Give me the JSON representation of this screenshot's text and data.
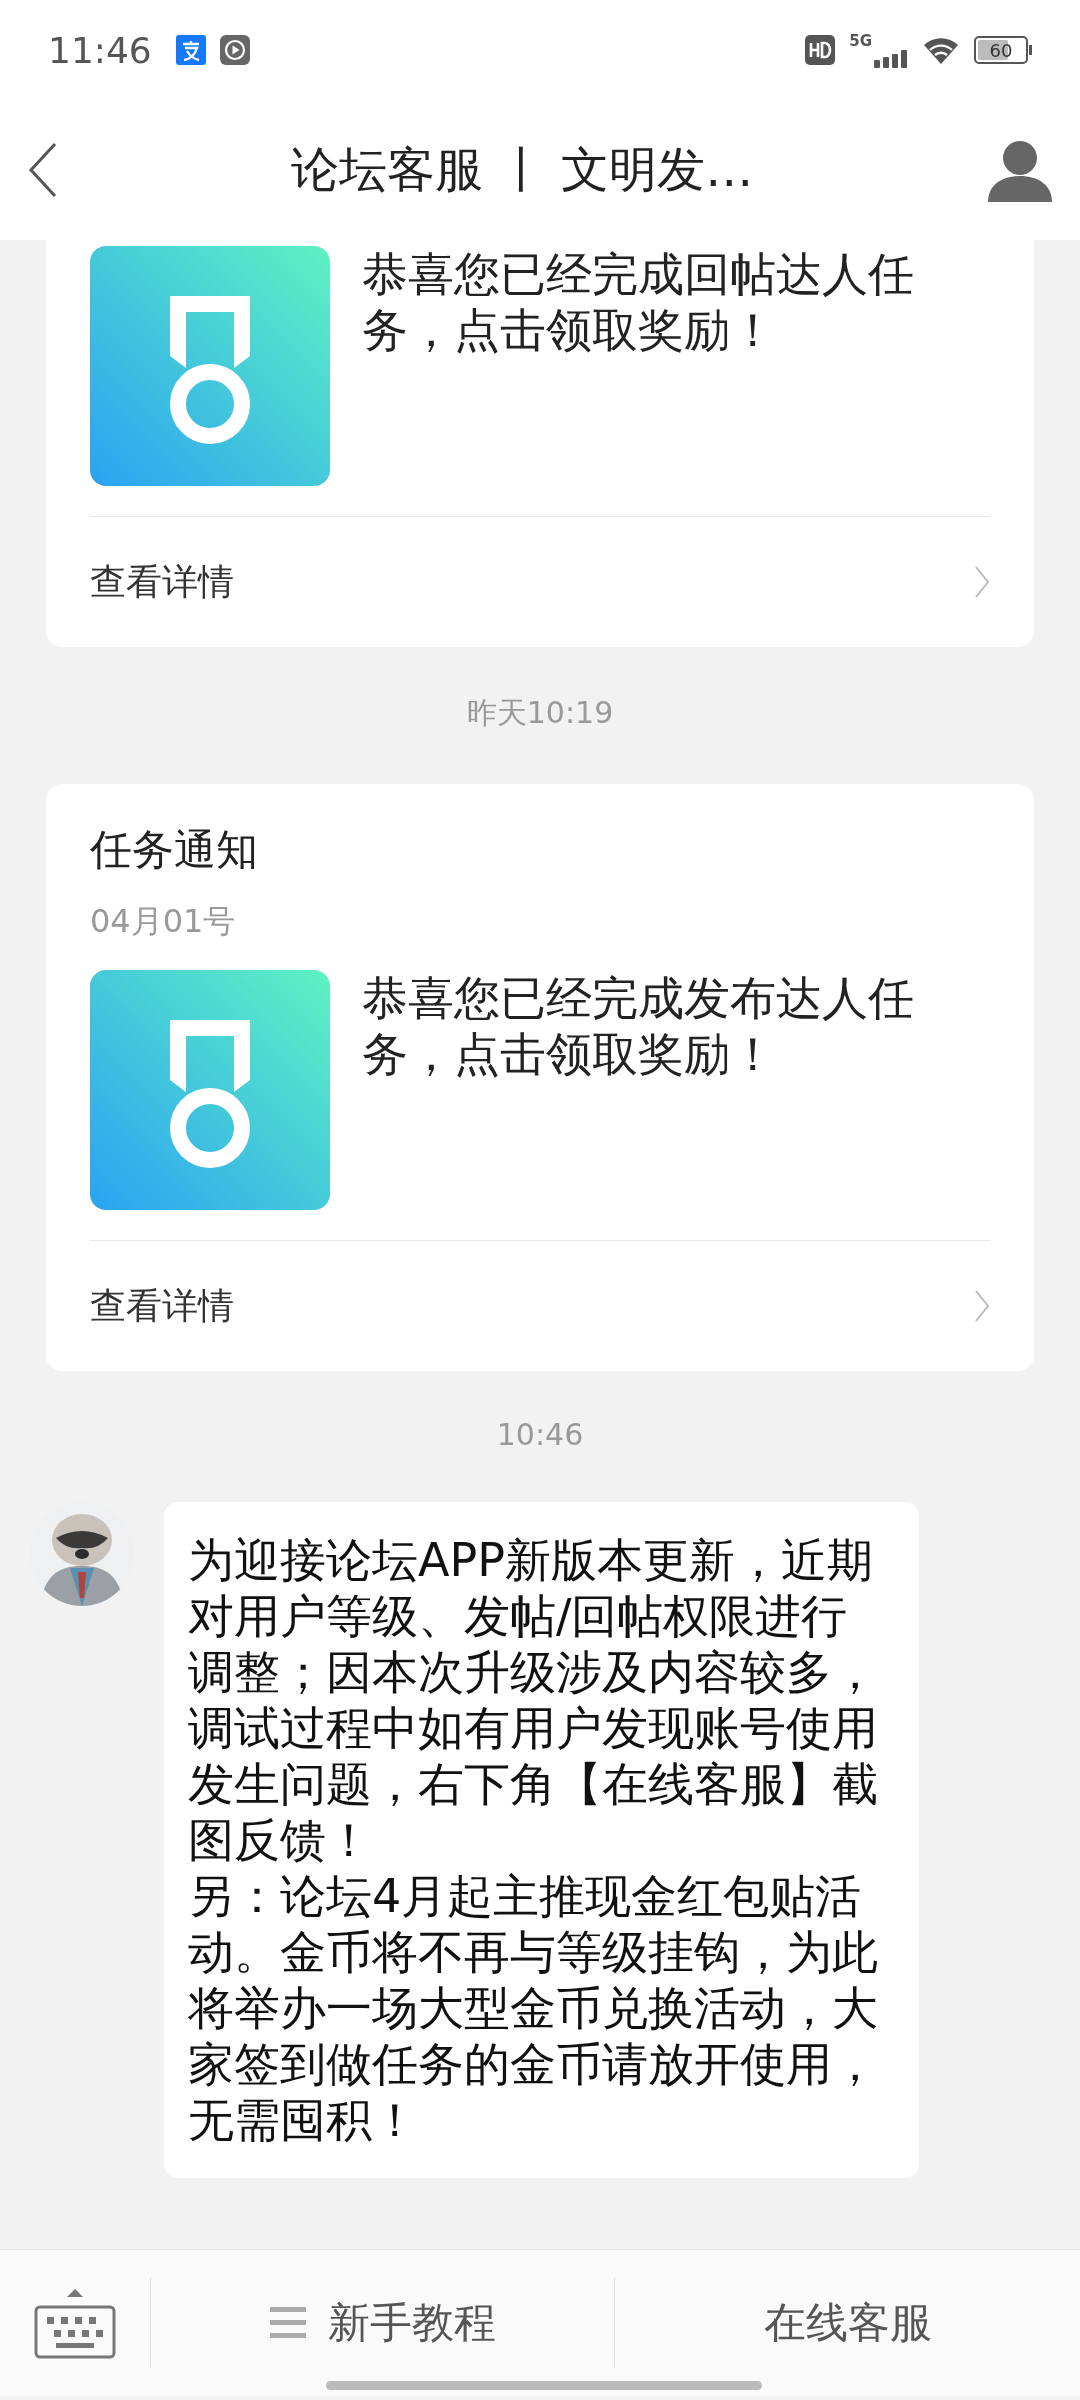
{
  "status_bar": {
    "time": "11:46",
    "battery": "60",
    "network": "5G"
  },
  "header": {
    "title": "论坛客服 丨 文明发…"
  },
  "messages": [
    {
      "kind": "task",
      "text": "恭喜您已经完成回帖达人任务，点击领取奖励！",
      "link": "查看详情"
    },
    {
      "kind": "time",
      "text": "昨天10:19"
    },
    {
      "kind": "task",
      "title": "任务通知",
      "date": "04月01号",
      "text": "恭喜您已经完成发布达人任务，点击领取奖励！",
      "link": "查看详情"
    },
    {
      "kind": "time",
      "text": "10:46"
    },
    {
      "kind": "chat",
      "paragraphs": [
        "为迎接论坛APP新版本更新，近期对用户等级、发帖/回帖权限进行调整；因本次升级涉及内容较多，调试过程中如有用户发现账号使用发生问题，右下角【在线客服】截图反馈！",
        "另：论坛4月起主推现金红包贴活动。金币将不再与等级挂钩，为此将举办一场大型金币兑换活动，大家签到做任务的金币请放开使用，无需囤积！"
      ]
    }
  ],
  "bottom_bar": {
    "menu": "新手教程",
    "service": "在线客服"
  }
}
